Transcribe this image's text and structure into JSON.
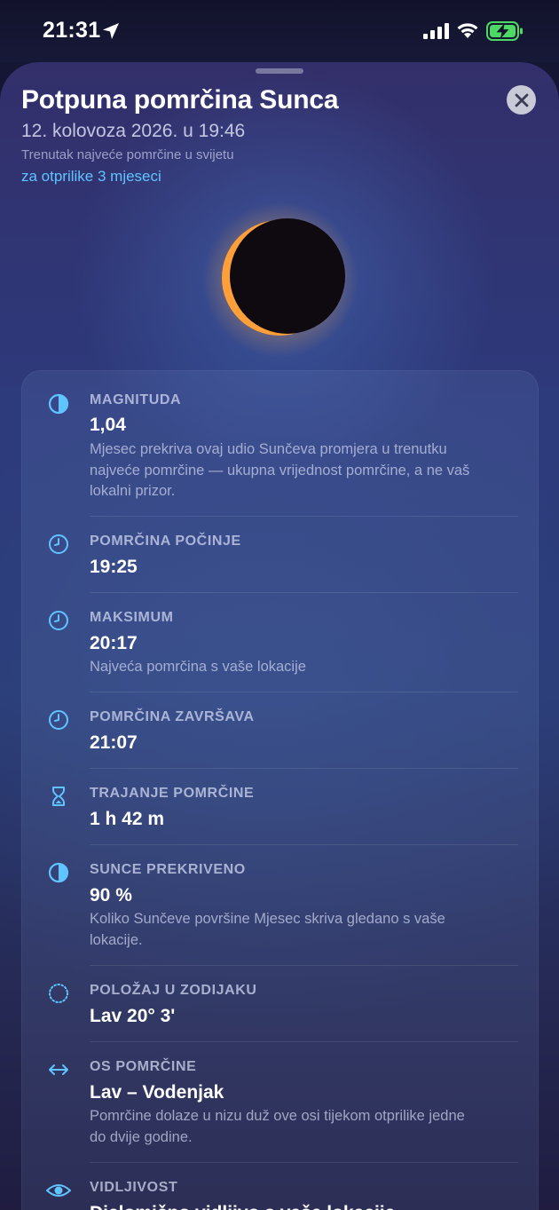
{
  "status_bar": {
    "time": "21:31",
    "icons": [
      "location-arrow-icon",
      "cellular-signal-icon",
      "wifi-icon",
      "battery-charging-icon"
    ]
  },
  "sheet": {
    "title": "Potpuna pomrčina Sunca",
    "date": "12. kolovoza 2026. u 19:46",
    "note": "Trenutak najveće pomrčine u svijetu",
    "countdown": "za otprilike 3 mjeseci",
    "close_icon": "close-icon",
    "accent": "#5fc4ff"
  },
  "details": [
    {
      "icon": "half-circle-icon",
      "label": "MAGNITUDA",
      "value": "1,04",
      "desc": "Mjesec prekriva ovaj udio Sunčeva promjera u trenutku najveće pomrčine — ukupna vrijednost pomrčine, a ne vaš lokalni prizor."
    },
    {
      "icon": "clock-icon",
      "label": "POMRČINA POČINJE",
      "value": "19:25",
      "desc": ""
    },
    {
      "icon": "clock-icon",
      "label": "MAKSIMUM",
      "value": "20:17",
      "desc": "Najveća pomrčina s vaše lokacije"
    },
    {
      "icon": "clock-icon",
      "label": "POMRČINA ZAVRŠAVA",
      "value": "21:07",
      "desc": ""
    },
    {
      "icon": "hourglass-icon",
      "label": "TRAJANJE POMRČINE",
      "value": "1 h 42 m",
      "desc": ""
    },
    {
      "icon": "half-circle-icon",
      "label": "SUNCE PREKRIVENO",
      "value": "90 %",
      "desc": "Koliko Sunčeve površine Mjesec skriva gledano s vaše lokacije."
    },
    {
      "icon": "dotted-circle-icon",
      "label": "POLOŽAJ U ZODIJAKU",
      "value": "Lav 20° 3'",
      "desc": ""
    },
    {
      "icon": "double-arrow-icon",
      "label": "OS POMRČINE",
      "value": "Lav – Vodenjak",
      "desc": "Pomrčine dolaze u nizu duž ove osi tijekom otprilike jedne do dvije godine."
    },
    {
      "icon": "eye-icon",
      "label": "VIDLJIVOST",
      "value": "Djelomično vidljivo s vaše lokacije",
      "desc": ""
    }
  ]
}
